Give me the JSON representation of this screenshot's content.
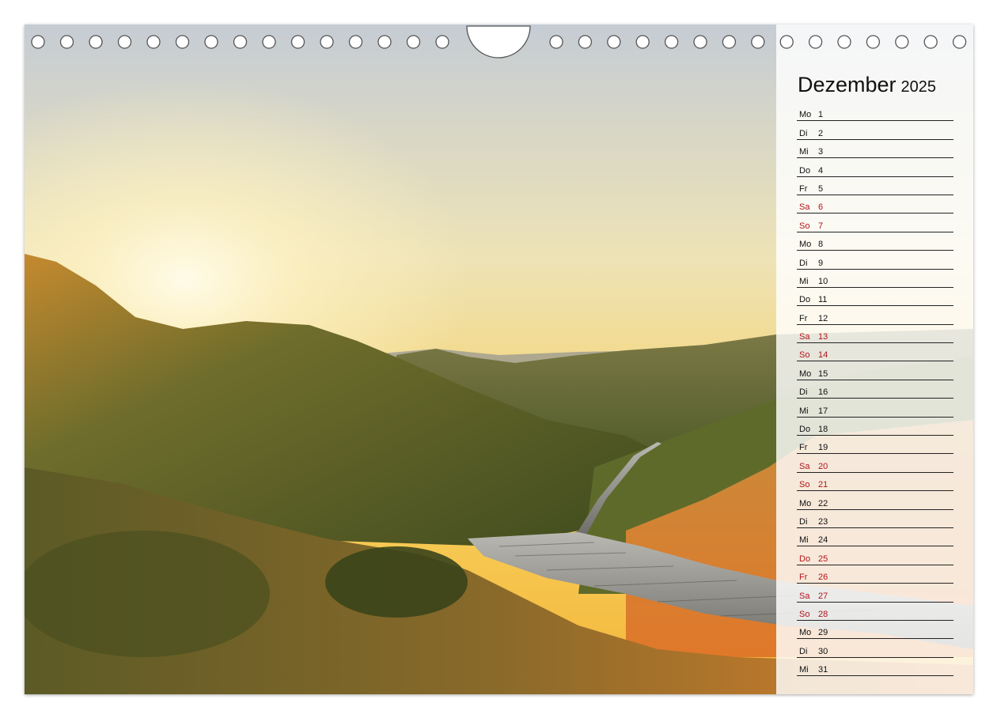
{
  "calendar": {
    "month": "Dezember",
    "year": "2025",
    "days": [
      {
        "abbr": "Mo",
        "num": "1",
        "weekend": false
      },
      {
        "abbr": "Di",
        "num": "2",
        "weekend": false
      },
      {
        "abbr": "Mi",
        "num": "3",
        "weekend": false
      },
      {
        "abbr": "Do",
        "num": "4",
        "weekend": false
      },
      {
        "abbr": "Fr",
        "num": "5",
        "weekend": false
      },
      {
        "abbr": "Sa",
        "num": "6",
        "weekend": true
      },
      {
        "abbr": "So",
        "num": "7",
        "weekend": true
      },
      {
        "abbr": "Mo",
        "num": "8",
        "weekend": false
      },
      {
        "abbr": "Di",
        "num": "9",
        "weekend": false
      },
      {
        "abbr": "Mi",
        "num": "10",
        "weekend": false
      },
      {
        "abbr": "Do",
        "num": "11",
        "weekend": false
      },
      {
        "abbr": "Fr",
        "num": "12",
        "weekend": false
      },
      {
        "abbr": "Sa",
        "num": "13",
        "weekend": true
      },
      {
        "abbr": "So",
        "num": "14",
        "weekend": true
      },
      {
        "abbr": "Mo",
        "num": "15",
        "weekend": false
      },
      {
        "abbr": "Di",
        "num": "16",
        "weekend": false
      },
      {
        "abbr": "Mi",
        "num": "17",
        "weekend": false
      },
      {
        "abbr": "Do",
        "num": "18",
        "weekend": false
      },
      {
        "abbr": "Fr",
        "num": "19",
        "weekend": false
      },
      {
        "abbr": "Sa",
        "num": "20",
        "weekend": true
      },
      {
        "abbr": "So",
        "num": "21",
        "weekend": true
      },
      {
        "abbr": "Mo",
        "num": "22",
        "weekend": false
      },
      {
        "abbr": "Di",
        "num": "23",
        "weekend": false
      },
      {
        "abbr": "Mi",
        "num": "24",
        "weekend": false
      },
      {
        "abbr": "Do",
        "num": "25",
        "weekend": true
      },
      {
        "abbr": "Fr",
        "num": "26",
        "weekend": true
      },
      {
        "abbr": "Sa",
        "num": "27",
        "weekend": true
      },
      {
        "abbr": "So",
        "num": "28",
        "weekend": true
      },
      {
        "abbr": "Mo",
        "num": "29",
        "weekend": false
      },
      {
        "abbr": "Di",
        "num": "30",
        "weekend": false
      },
      {
        "abbr": "Mi",
        "num": "31",
        "weekend": false
      }
    ]
  },
  "colors": {
    "weekend_text": "#b3141b",
    "rule_line": "#222222",
    "sky_top": "#c9cfd6",
    "sky_horizon": "#f6c64a",
    "dune_grass": "#5f6a2c",
    "dune_orange": "#d98a2a",
    "boardwalk": "#8a8a86"
  }
}
